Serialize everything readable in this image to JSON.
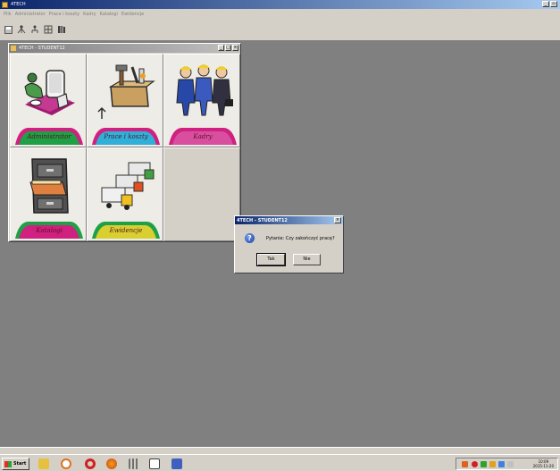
{
  "app": {
    "title": "4TECH",
    "menu": [
      "Plik",
      "Administrator",
      "Prace i koszty",
      "Kadry",
      "Katalogi",
      "Ewidencje"
    ],
    "toolbar_icons": [
      "save-icon",
      "people-icon",
      "tree-icon",
      "grid-icon",
      "books-icon"
    ]
  },
  "child_window": {
    "title": "4TECH - STUDENT12",
    "tiles": [
      {
        "label": "Administrator",
        "icon": "computer-admin-icon"
      },
      {
        "label": "Prace i koszty",
        "icon": "toolbox-icon"
      },
      {
        "label": "Kadry",
        "icon": "workers-icon"
      },
      {
        "label": "Katalogi",
        "icon": "filing-cabinet-icon"
      },
      {
        "label": "Ewidencje",
        "icon": "trucks-icon"
      }
    ]
  },
  "dialog": {
    "title": "4TECH - STUDENT12",
    "message": "Pytanie: Czy zakończyć pracę?",
    "ok_label": "Tak",
    "no_label": "Nie"
  },
  "taskbar": {
    "start_label": "Start",
    "clock_time": "10:09",
    "clock_date": "2015-11-20"
  },
  "colors": {
    "desktop": "#808080",
    "title_active": "#0a246a",
    "tab_pink": "#d02080",
    "tab_green": "#1fa046"
  }
}
